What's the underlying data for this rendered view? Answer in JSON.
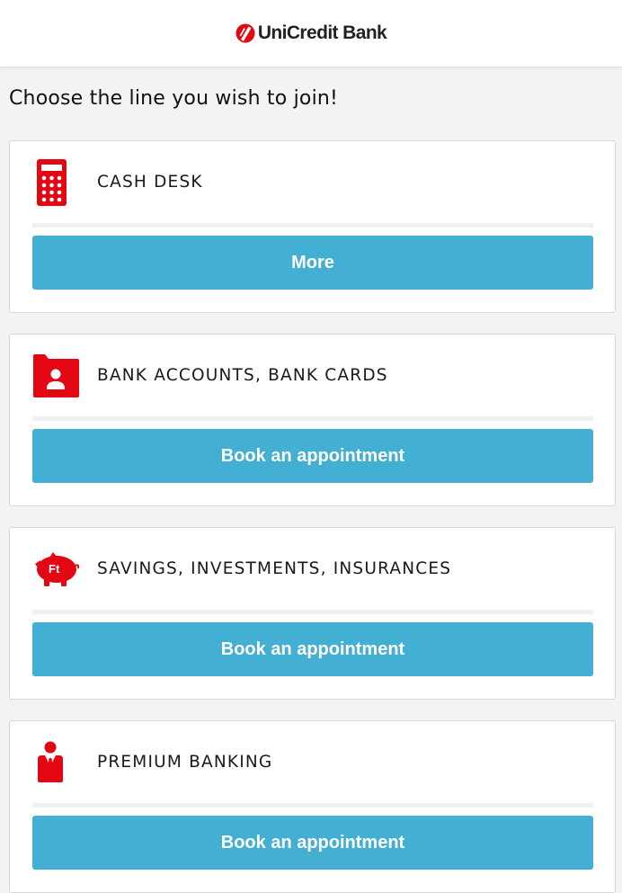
{
  "brand": {
    "name": "UniCredit Bank",
    "accent": "#e30613"
  },
  "page": {
    "title": "Choose the line you wish to join!"
  },
  "colors": {
    "button": "#43afd3",
    "background": "#f3f3f3",
    "icon": "#e30613"
  },
  "lines": [
    {
      "label": "CASH DESK",
      "icon": "calculator-icon",
      "action": "More"
    },
    {
      "label": "BANK ACCOUNTS, BANK CARDS",
      "icon": "account-folder-icon",
      "action": "Book an appointment"
    },
    {
      "label": "SAVINGS, INVESTMENTS, INSURANCES",
      "icon": "piggy-bank-icon",
      "icon_text": "Ft",
      "action": "Book an appointment"
    },
    {
      "label": "PREMIUM BANKING",
      "icon": "businessman-icon",
      "action": "Book an appointment"
    }
  ]
}
